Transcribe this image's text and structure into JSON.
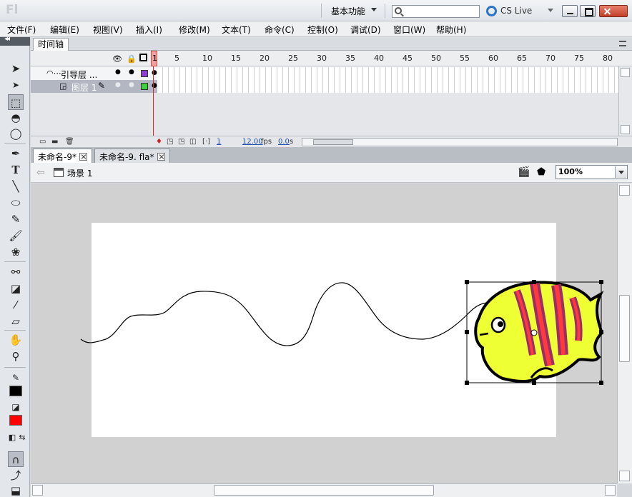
{
  "titlebar": {
    "logo": "Fl",
    "workspace": "基本功能",
    "search_placeholder": "",
    "cs_live": "CS Live"
  },
  "menu": [
    "文件(F)",
    "编辑(E)",
    "视图(V)",
    "插入(I)",
    "修改(M)",
    "文本(T)",
    "命令(C)",
    "控制(O)",
    "调试(D)",
    "窗口(W)",
    "帮助(H)"
  ],
  "timeline": {
    "tab": "时间轴",
    "frame_ticks": [
      "5",
      "10",
      "15",
      "20",
      "25",
      "30",
      "35",
      "40",
      "45",
      "50",
      "55",
      "60",
      "65",
      "70",
      "75",
      "80"
    ],
    "current_frame": "1",
    "layers": [
      {
        "name": "引导层 ...",
        "color": "#8b3fd2"
      },
      {
        "name": "图层 1",
        "color": "#3cd23c"
      }
    ],
    "status_frame": "1",
    "fps": "12.00",
    "fps_unit": "fps",
    "time": "0.0",
    "time_unit": "s"
  },
  "documents": {
    "tabs": [
      "未命名-9*",
      "未命名-9. fla*"
    ]
  },
  "editbar": {
    "scene": "场景 1",
    "zoom": "100%"
  },
  "colors": {
    "stroke": "#000000",
    "fill": "#ff0000",
    "fish_body": "#eeff33",
    "fish_stripe_outer": "#9b2d6b",
    "fish_stripe_inner": "#ff3a3a"
  },
  "tools": [
    "selection-icon",
    "subselection-icon",
    "free-transform-icon",
    "3d-rotation-icon",
    "lasso-icon",
    "pen-icon",
    "text-icon",
    "line-icon",
    "oval-icon",
    "pencil-icon",
    "brush-icon",
    "deco-icon",
    "bone-icon",
    "paint-bucket-icon",
    "eyedropper-icon",
    "eraser-icon",
    "hand-icon",
    "zoom-icon",
    "stroke-color-icon",
    "fill-color-icon",
    "snap-icon"
  ]
}
